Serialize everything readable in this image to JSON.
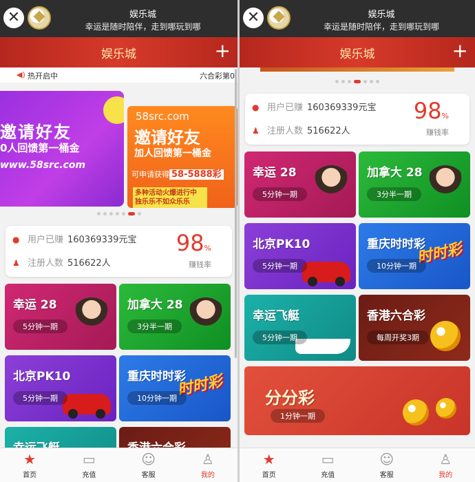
{
  "system_bar": {
    "close_label": "✕",
    "title": "娱乐城",
    "subtitle": "幸运是随时陪伴，走到哪玩到哪"
  },
  "header": {
    "title": "娱乐城",
    "plus_label": "+"
  },
  "ticker": {
    "left": "热开启中",
    "right": "六合彩第0"
  },
  "banner": {
    "slide_a": {
      "headline": "邀请好友",
      "line2": "0人回馈第一桶金",
      "url": "www.58src.com"
    },
    "slide_b": {
      "site": "58src.com",
      "headline": "邀请好友",
      "line2": "加人回馈第一桶金",
      "apply_prefix": "可申请获得",
      "apply_amount": "58-5888彩",
      "promo_line1": "多种活动火爆进行中",
      "promo_line2": "独乐乐不如众乐乐"
    }
  },
  "stats": {
    "earned_label": "用户已赚",
    "earned_value": "160369339元宝",
    "users_label": "注册人数",
    "users_value": "516622人",
    "rate_value": "98",
    "rate_unit": "%",
    "rate_label": "赚钱率"
  },
  "games": [
    {
      "name": "幸运 28",
      "tag": "5分钟一期",
      "color": "pink"
    },
    {
      "name": "加拿大 28",
      "tag": "3分半一期",
      "color": "green"
    },
    {
      "name": "北京PK10",
      "tag": "5分钟一期",
      "color": "purple"
    },
    {
      "name": "重庆时时彩",
      "tag": "10分钟一期",
      "color": "blue"
    },
    {
      "name": "幸运飞艇",
      "tag": "5分钟一期",
      "color": "teal"
    },
    {
      "name": "香港六合彩",
      "tag": "每周开奖3期",
      "color": "maroon"
    },
    {
      "name": "分分彩",
      "tag": "1分钟一期",
      "color": "red"
    }
  ],
  "lottery_logo_text": "时时彩",
  "tabs": [
    {
      "label": "首页",
      "icon": "star-icon"
    },
    {
      "label": "充值",
      "icon": "wallet-icon"
    },
    {
      "label": "客服",
      "icon": "smile-icon"
    },
    {
      "label": "我的",
      "icon": "user-icon"
    }
  ],
  "colors": {
    "accent": "#e23a2c",
    "header": "#c72f22",
    "sysbar": "#2e2e2e"
  }
}
